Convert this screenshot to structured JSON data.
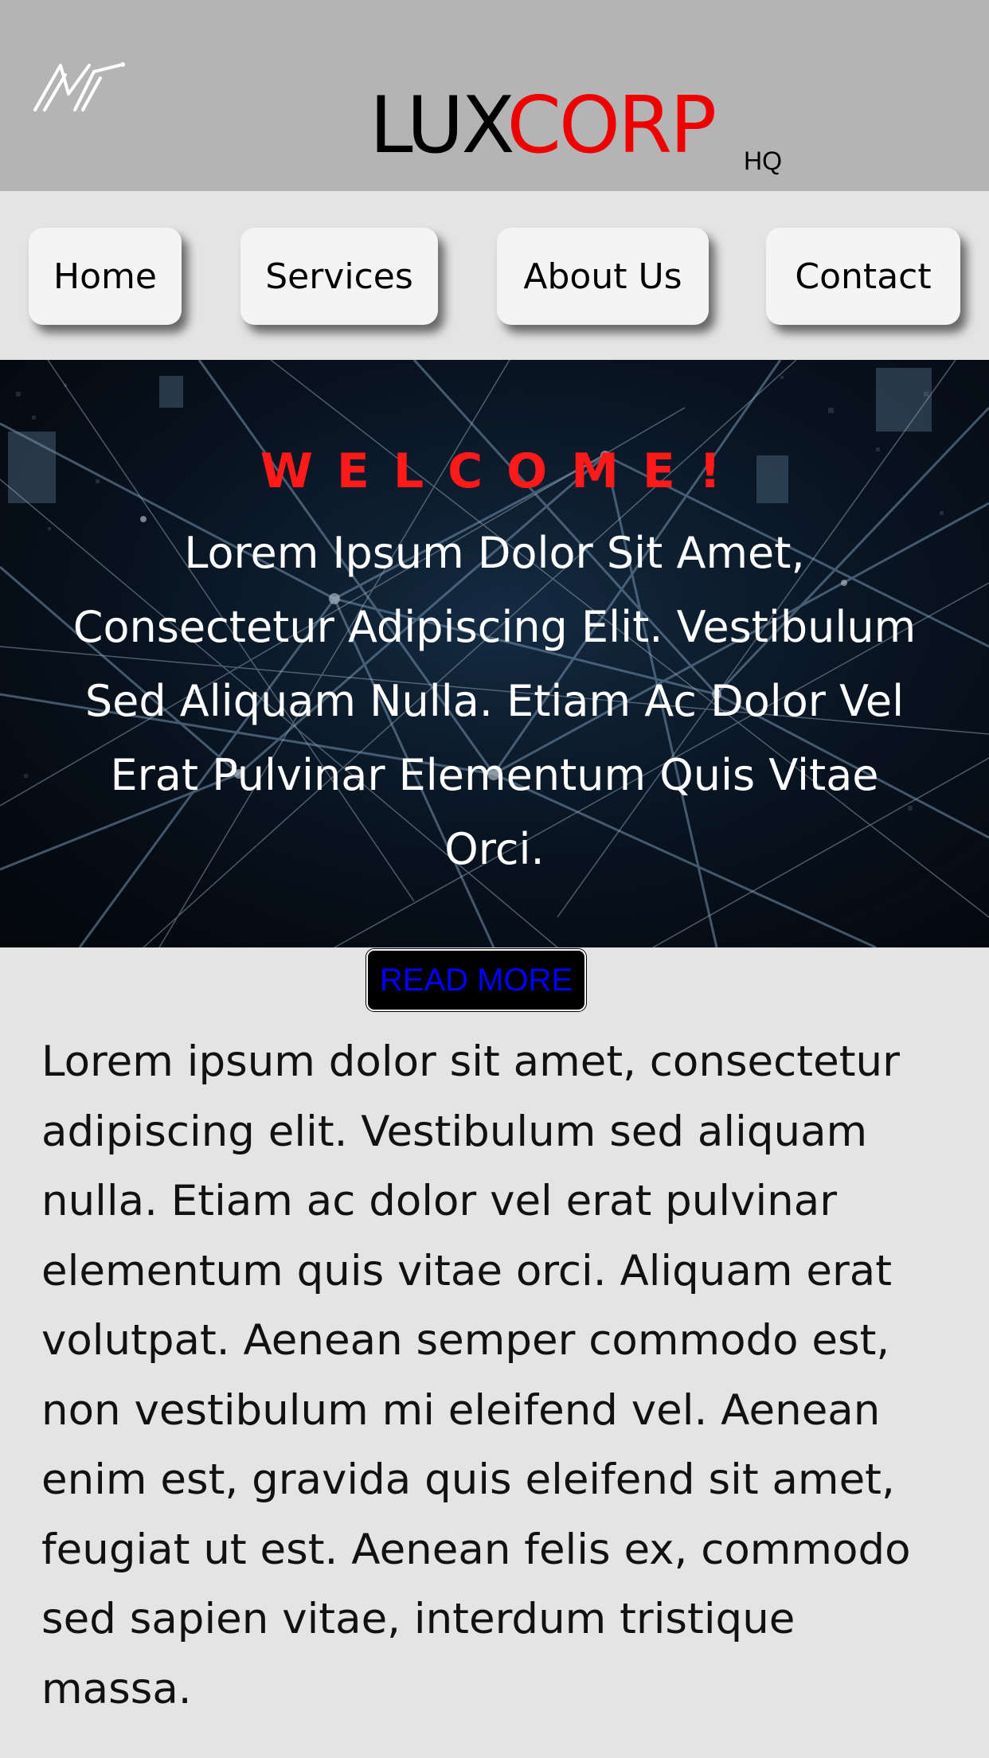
{
  "header": {
    "logo_icon": "av-monogram-logo",
    "brand_part1": "LUX",
    "brand_part2": "CORP",
    "brand_suffix": "HQ",
    "colors": {
      "background": "#b4b4b4",
      "brand_accent": "#ee0000"
    }
  },
  "nav": {
    "items": [
      {
        "label": "Home"
      },
      {
        "label": "Services"
      },
      {
        "label": "About Us"
      },
      {
        "label": "Contact"
      }
    ]
  },
  "hero": {
    "welcome": "WELCOME!",
    "body": "Lorem Ipsum Dolor Sit Amet, Consectetur Adipiscing Elit. Vestibulum Sed Aliquam Nulla. Etiam Ac Dolor Vel Erat Pulvinar Elementum Quis Vitae Orci.",
    "welcome_color": "#ff1a1a"
  },
  "read_more": {
    "label": "READ MORE",
    "text_color": "#0000ff"
  },
  "content": {
    "paragraph": "Lorem ipsum dolor sit amet, consectetur adipiscing elit. Vestibulum sed aliquam nulla. Etiam ac dolor vel erat pulvinar elementum quis vitae orci. Aliquam erat volutpat. Aenean semper commodo est, non vestibulum mi eleifend vel. Aenean enim est, gravida quis eleifend sit amet, feugiat ut est. Aenean felis ex, commodo sed sapien vitae, interdum tristique massa."
  }
}
